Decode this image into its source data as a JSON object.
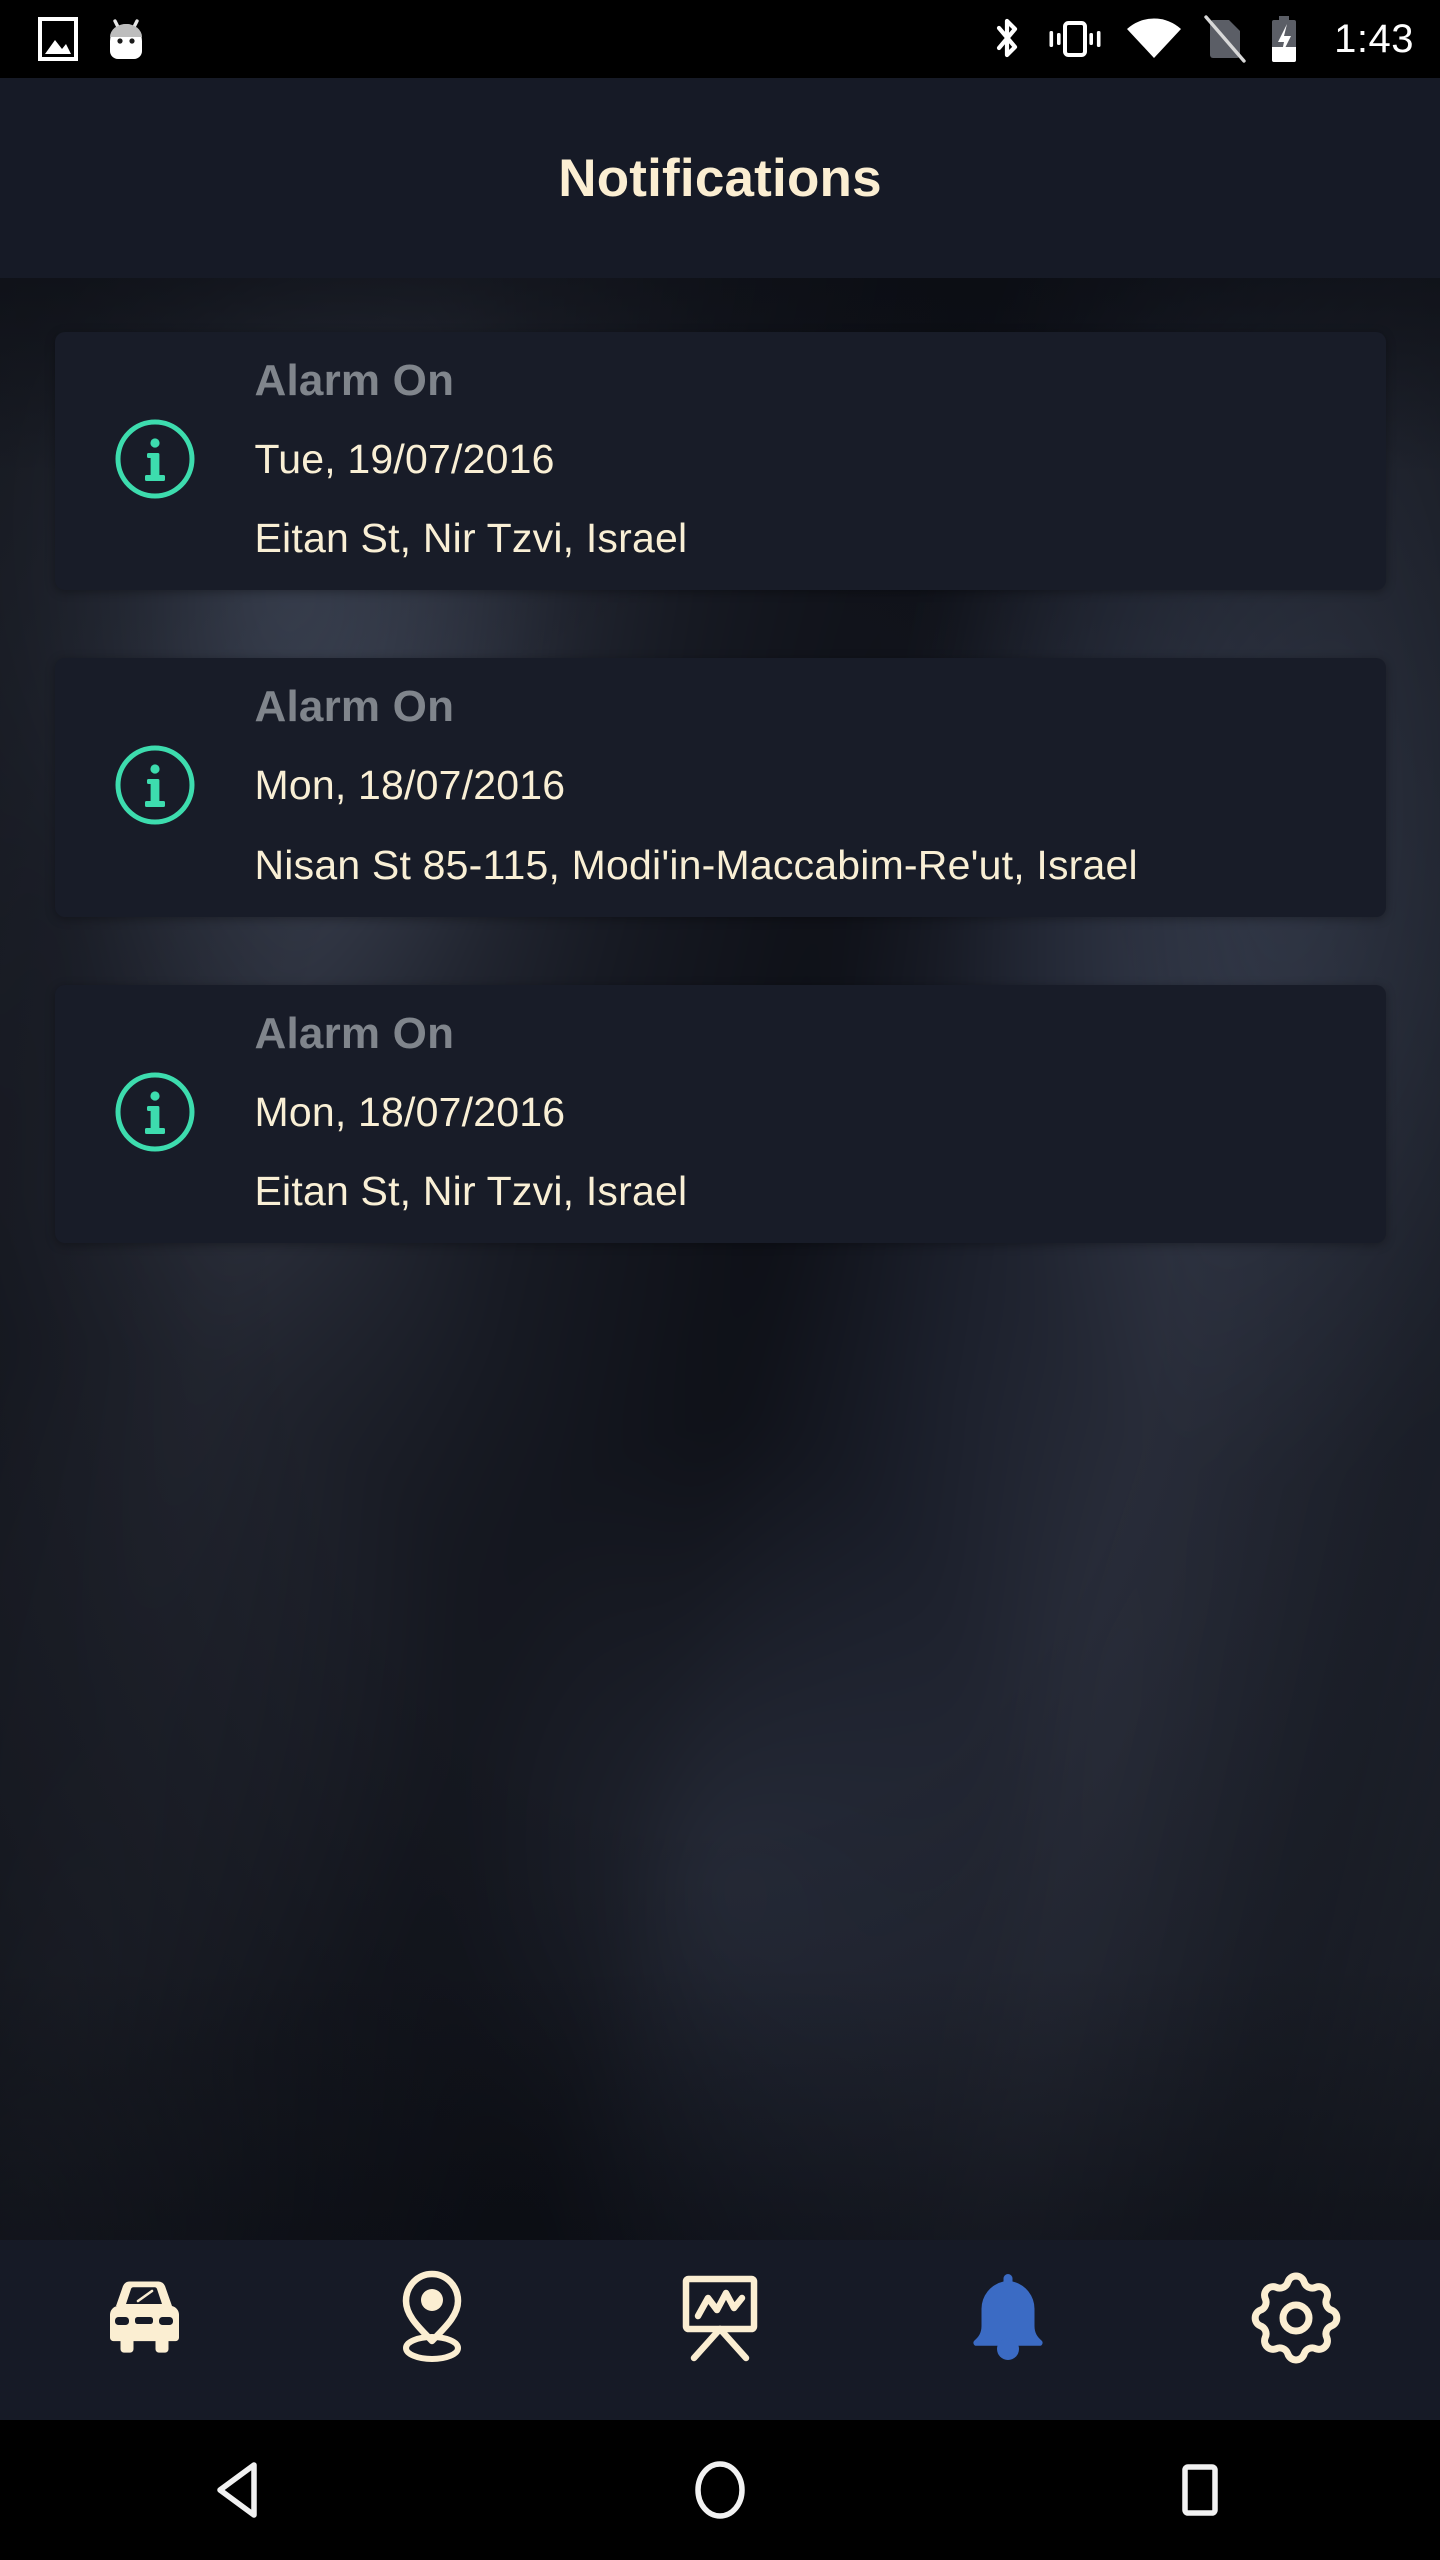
{
  "statusbar": {
    "time": "1:43",
    "icons_left": [
      "photo-icon",
      "android-head-icon"
    ],
    "icons_right": [
      "bluetooth-icon",
      "vibrate-icon",
      "wifi-icon",
      "no-sim-icon",
      "battery-charging-icon"
    ]
  },
  "header": {
    "title": "Notifications",
    "title_color": "#fbeed2",
    "background_color": "#161a26"
  },
  "theme": {
    "card_background": "#181c28",
    "accent_teal": "#3ddcae",
    "text_cream": "#f9efd5",
    "text_muted": "#80858c",
    "active_tab_blue": "#3b6bc4",
    "tabbar_background": "#161a26"
  },
  "notifications": [
    {
      "icon": "info-circle-icon",
      "title": "Alarm On",
      "date": "Tue, 19/07/2016",
      "address": "Eitan St, Nir Tzvi, Israel"
    },
    {
      "icon": "info-circle-icon",
      "title": "Alarm On",
      "date": "Mon, 18/07/2016",
      "address": "Nisan St 85-115, Modi'in-Maccabim-Re'ut, Israel"
    },
    {
      "icon": "info-circle-icon",
      "title": "Alarm On",
      "date": "Mon, 18/07/2016",
      "address": "Eitan St, Nir Tzvi, Israel"
    }
  ],
  "tabs": [
    {
      "icon": "car-icon",
      "name": "vehicle",
      "active": false
    },
    {
      "icon": "location-pin-icon",
      "name": "location",
      "active": false
    },
    {
      "icon": "chart-easel-icon",
      "name": "reports",
      "active": false
    },
    {
      "icon": "bell-icon",
      "name": "notifications",
      "active": true
    },
    {
      "icon": "gear-icon",
      "name": "settings",
      "active": false
    }
  ],
  "navbar": {
    "back": "back-triangle-icon",
    "home": "home-circle-icon",
    "recents": "recents-square-icon"
  }
}
